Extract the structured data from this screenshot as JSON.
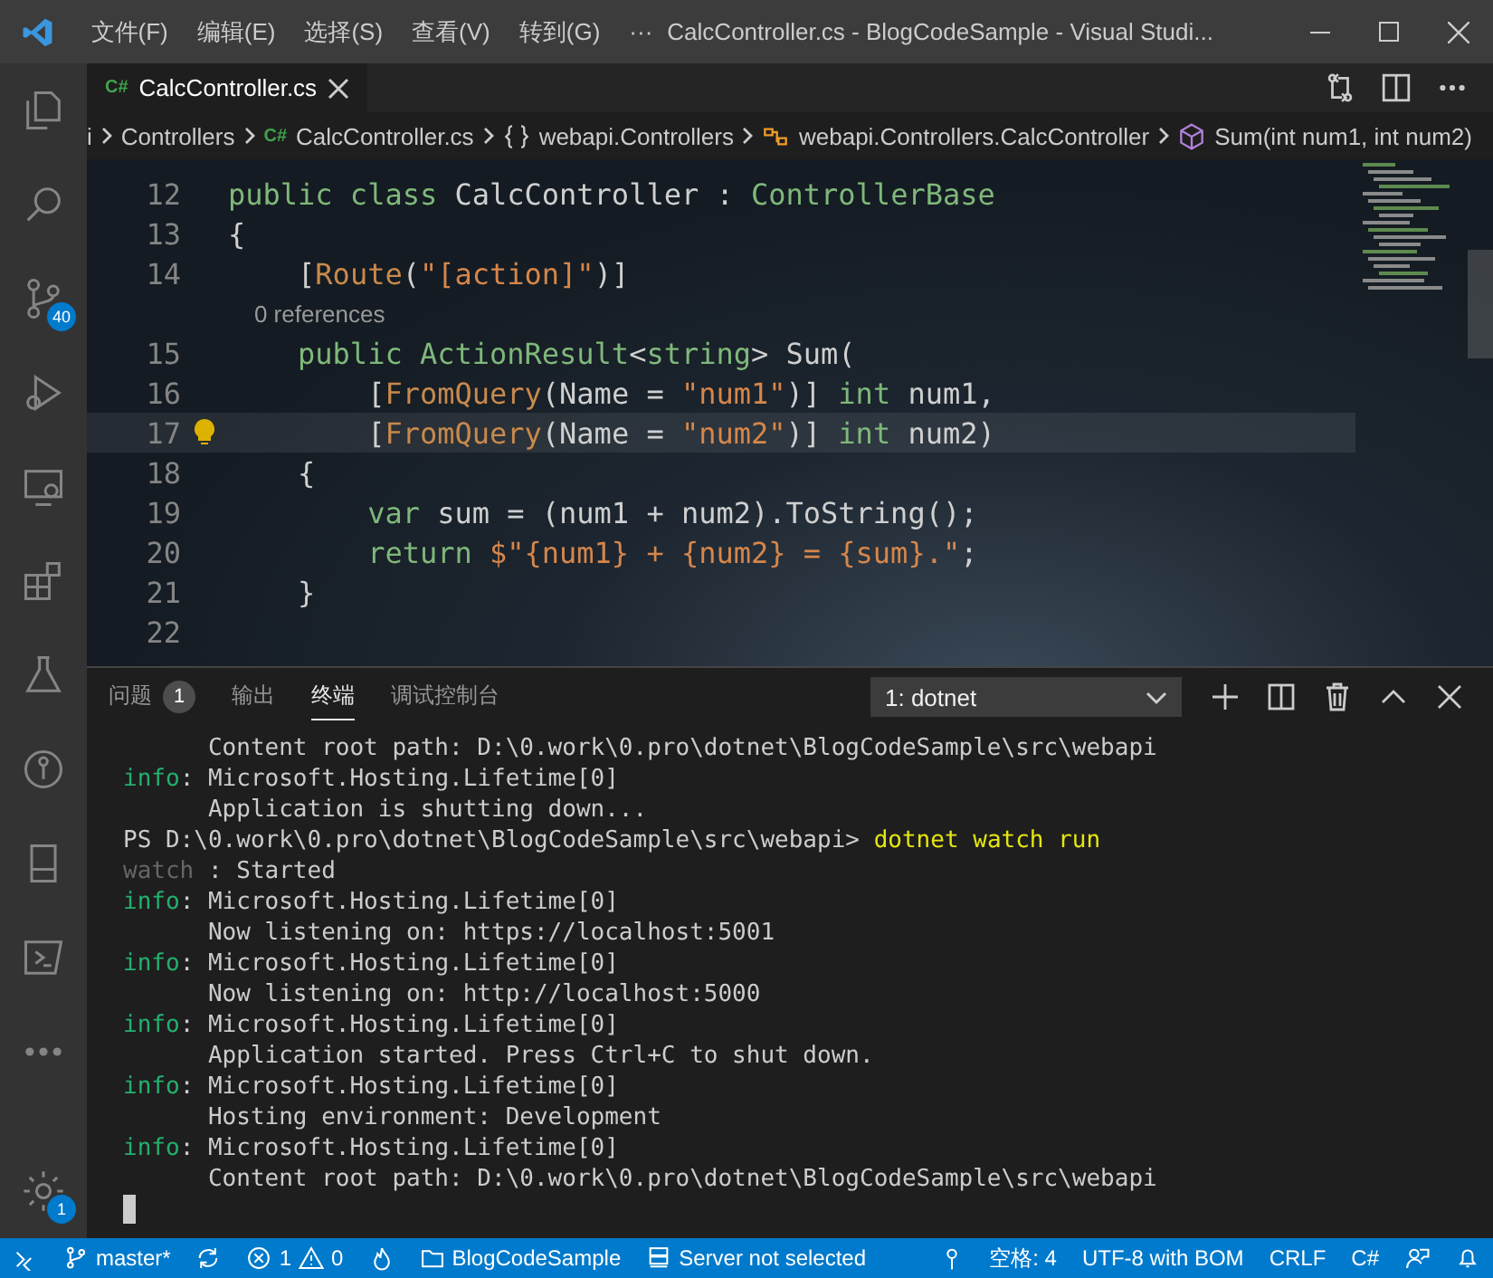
{
  "window": {
    "title": "CalcController.cs - BlogCodeSample - Visual Studi...",
    "menus": [
      "文件(F)",
      "编辑(E)",
      "选择(S)",
      "查看(V)",
      "转到(G)"
    ],
    "more": "···"
  },
  "activity_bar": {
    "items": [
      {
        "kind": "explorer"
      },
      {
        "kind": "search"
      },
      {
        "kind": "scm",
        "badge": "40"
      },
      {
        "kind": "debug"
      },
      {
        "kind": "remote"
      },
      {
        "kind": "extensions"
      },
      {
        "kind": "test"
      },
      {
        "kind": "git"
      },
      {
        "kind": "device"
      },
      {
        "kind": "terminal"
      },
      {
        "kind": "more"
      }
    ],
    "bottom": [
      {
        "kind": "settings",
        "badge": "1"
      }
    ]
  },
  "editor_tabs": [
    {
      "label": "CalcController.cs",
      "icon_label": "C#",
      "selected": true
    }
  ],
  "breadcrumbs": [
    {
      "kind": "text",
      "label": "i"
    },
    {
      "kind": "text",
      "label": "Controllers"
    },
    {
      "kind": "file",
      "label": "CalcController.cs",
      "icon_label": "C#"
    },
    {
      "kind": "namespace",
      "label": "webapi.Controllers"
    },
    {
      "kind": "class",
      "label": "webapi.Controllers.CalcController"
    },
    {
      "kind": "method",
      "label": "Sum(int num1, int num2)"
    }
  ],
  "editor_lines": [
    {
      "kind": "code",
      "number": "12",
      "segments": [
        {
          "kind": "kw",
          "text": "public class "
        },
        {
          "kind": "plain",
          "text": "CalcController : "
        },
        {
          "kind": "kw",
          "text": "ControllerBase"
        }
      ]
    },
    {
      "kind": "code",
      "number": "13",
      "segments": [
        {
          "kind": "plain",
          "text": "{"
        }
      ]
    },
    {
      "kind": "code",
      "number": "14",
      "segments": [
        {
          "kind": "plain",
          "text": "    ["
        },
        {
          "kind": "attr",
          "text": "Route"
        },
        {
          "kind": "plain",
          "text": "("
        },
        {
          "kind": "str",
          "text": "\"[action]\""
        },
        {
          "kind": "plain",
          "text": ")]"
        }
      ]
    },
    {
      "kind": "codelens",
      "text": "    0 references"
    },
    {
      "kind": "code",
      "number": "15",
      "segments": [
        {
          "kind": "kw",
          "text": "    public ActionResult"
        },
        {
          "kind": "plain",
          "text": "<"
        },
        {
          "kind": "kw",
          "text": "string"
        },
        {
          "kind": "plain",
          "text": "> Sum("
        }
      ]
    },
    {
      "kind": "code",
      "number": "16",
      "segments": [
        {
          "kind": "plain",
          "text": "        ["
        },
        {
          "kind": "attr",
          "text": "FromQuery"
        },
        {
          "kind": "plain",
          "text": "(Name = "
        },
        {
          "kind": "str",
          "text": "\"num1\""
        },
        {
          "kind": "plain",
          "text": ")] "
        },
        {
          "kind": "kw",
          "text": "int"
        },
        {
          "kind": "plain",
          "text": " num1,"
        }
      ]
    },
    {
      "kind": "code",
      "number": "17",
      "current": true,
      "lightbulb": true,
      "segments": [
        {
          "kind": "plain",
          "text": "        ["
        },
        {
          "kind": "attr",
          "text": "FromQuery"
        },
        {
          "kind": "plain",
          "text": "(Name = "
        },
        {
          "kind": "str",
          "text": "\"num2\""
        },
        {
          "kind": "plain",
          "text": ")] "
        },
        {
          "kind": "kw",
          "text": "int"
        },
        {
          "kind": "plain",
          "text": " num2)"
        }
      ]
    },
    {
      "kind": "code",
      "number": "18",
      "segments": [
        {
          "kind": "plain",
          "text": "    {"
        }
      ]
    },
    {
      "kind": "code",
      "number": "19",
      "segments": [
        {
          "kind": "kw",
          "text": "        var"
        },
        {
          "kind": "plain",
          "text": " sum = (num1 + num2).ToString();"
        }
      ]
    },
    {
      "kind": "code",
      "number": "20",
      "segments": [
        {
          "kind": "kw",
          "text": "        return "
        },
        {
          "kind": "str",
          "text": "$\"{num1} + {num2} = {sum}.\""
        },
        {
          "kind": "plain",
          "text": ";"
        }
      ]
    },
    {
      "kind": "code",
      "number": "21",
      "segments": [
        {
          "kind": "plain",
          "text": "    }"
        }
      ]
    },
    {
      "kind": "code",
      "number": "22"
    }
  ],
  "panel": {
    "tabs": [
      {
        "label": "问题",
        "count": "1",
        "selected": false
      },
      {
        "label": "输出",
        "selected": false
      },
      {
        "label": "终端",
        "selected": true
      },
      {
        "label": "调试控制台",
        "selected": false
      }
    ],
    "terminal_select": "1: dotnet",
    "terminal_lines": [
      [
        {
          "kind": "plain",
          "text": "      Content root path: D:\\0.work\\0.pro\\dotnet\\BlogCodeSample\\src\\webapi"
        }
      ],
      [
        {
          "kind": "info",
          "text": "info"
        },
        {
          "kind": "plain",
          "text": ": Microsoft.Hosting.Lifetime[0]"
        }
      ],
      [
        {
          "kind": "plain",
          "text": "      Application is shutting down..."
        }
      ],
      [
        {
          "kind": "plain",
          "text": "PS D:\\0.work\\0.pro\\dotnet\\BlogCodeSample\\src\\webapi> "
        },
        {
          "kind": "cmd",
          "text": "dotnet watch run"
        }
      ],
      [
        {
          "kind": "dim",
          "text": "watch"
        },
        {
          "kind": "plain",
          "text": " : Started"
        }
      ],
      [
        {
          "kind": "info",
          "text": "info"
        },
        {
          "kind": "plain",
          "text": ": Microsoft.Hosting.Lifetime[0]"
        }
      ],
      [
        {
          "kind": "plain",
          "text": "      Now listening on: https://localhost:5001"
        }
      ],
      [
        {
          "kind": "info",
          "text": "info"
        },
        {
          "kind": "plain",
          "text": ": Microsoft.Hosting.Lifetime[0]"
        }
      ],
      [
        {
          "kind": "plain",
          "text": "      Now listening on: http://localhost:5000"
        }
      ],
      [
        {
          "kind": "info",
          "text": "info"
        },
        {
          "kind": "plain",
          "text": ": Microsoft.Hosting.Lifetime[0]"
        }
      ],
      [
        {
          "kind": "plain",
          "text": "      Application started. Press Ctrl+C to shut down."
        }
      ],
      [
        {
          "kind": "info",
          "text": "info"
        },
        {
          "kind": "plain",
          "text": ": Microsoft.Hosting.Lifetime[0]"
        }
      ],
      [
        {
          "kind": "plain",
          "text": "      Hosting environment: Development"
        }
      ],
      [
        {
          "kind": "info",
          "text": "info"
        },
        {
          "kind": "plain",
          "text": ": Microsoft.Hosting.Lifetime[0]"
        }
      ],
      [
        {
          "kind": "plain",
          "text": "      Content root path: D:\\0.work\\0.pro\\dotnet\\BlogCodeSample\\src\\webapi"
        }
      ]
    ]
  },
  "status_bar": [
    {
      "kind": "remote"
    },
    {
      "kind": "branch",
      "label": "master*"
    },
    {
      "kind": "sync"
    },
    {
      "kind": "problems",
      "errors": "1",
      "warnings": "0"
    },
    {
      "kind": "flame"
    },
    {
      "kind": "folder",
      "label": "BlogCodeSample"
    },
    {
      "kind": "server",
      "label": "Server not selected"
    },
    {
      "kind": "pin"
    },
    {
      "kind": "text",
      "label": "空格: 4"
    },
    {
      "kind": "text",
      "label": "UTF-8 with BOM"
    },
    {
      "kind": "text",
      "label": "CRLF"
    },
    {
      "kind": "text",
      "label": "C#"
    },
    {
      "kind": "feedback"
    },
    {
      "kind": "bell"
    }
  ]
}
